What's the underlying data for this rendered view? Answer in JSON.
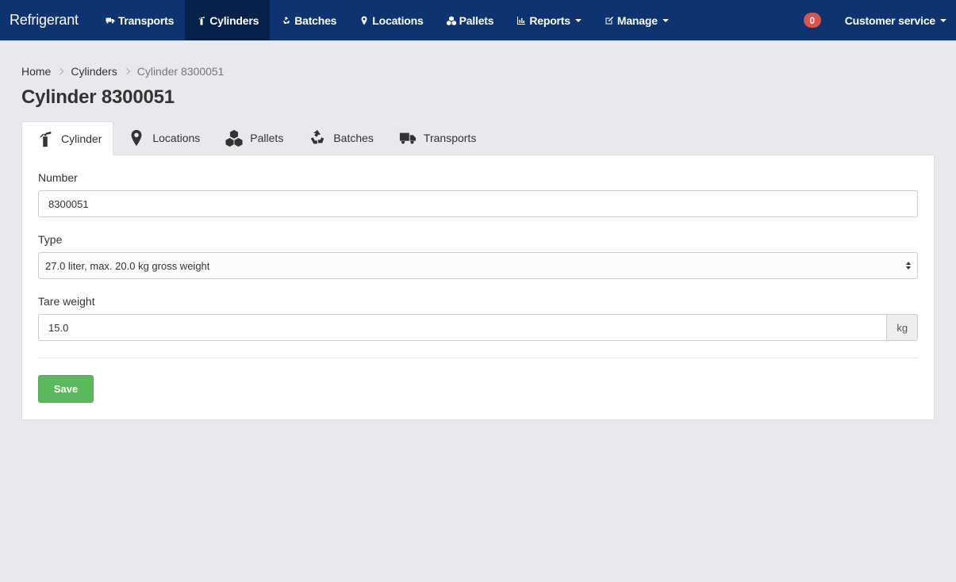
{
  "brand": "Refrigerant",
  "nav": {
    "items": [
      {
        "label": "Transports",
        "icon": "truck-icon"
      },
      {
        "label": "Cylinders",
        "icon": "fire-extinguisher-icon"
      },
      {
        "label": "Batches",
        "icon": "recycle-icon"
      },
      {
        "label": "Locations",
        "icon": "map-marker-icon"
      },
      {
        "label": "Pallets",
        "icon": "cubes-icon"
      },
      {
        "label": "Reports",
        "icon": "bar-chart-icon"
      },
      {
        "label": "Manage",
        "icon": "edit-icon"
      }
    ],
    "notification_count": "0",
    "user_menu": "Customer service"
  },
  "breadcrumb": {
    "home": "Home",
    "cylinders": "Cylinders",
    "current": "Cylinder 8300051"
  },
  "page_title": "Cylinder 8300051",
  "tabs": [
    {
      "label": "Cylinder",
      "icon": "fire-extinguisher-icon"
    },
    {
      "label": "Locations",
      "icon": "map-marker-icon"
    },
    {
      "label": "Pallets",
      "icon": "cubes-icon"
    },
    {
      "label": "Batches",
      "icon": "recycle-icon"
    },
    {
      "label": "Transports",
      "icon": "truck-icon"
    }
  ],
  "form": {
    "number_label": "Number",
    "number_value": "8300051",
    "type_label": "Type",
    "type_value": "27.0 liter, max. 20.0 kg gross weight",
    "tare_label": "Tare weight",
    "tare_value": "15.0",
    "tare_unit": "kg",
    "save_label": "Save"
  },
  "colors": {
    "navbar": "#0d3470",
    "navbar_active": "#06214a",
    "save_button": "#5cb85c",
    "badge": "#d9534f"
  }
}
